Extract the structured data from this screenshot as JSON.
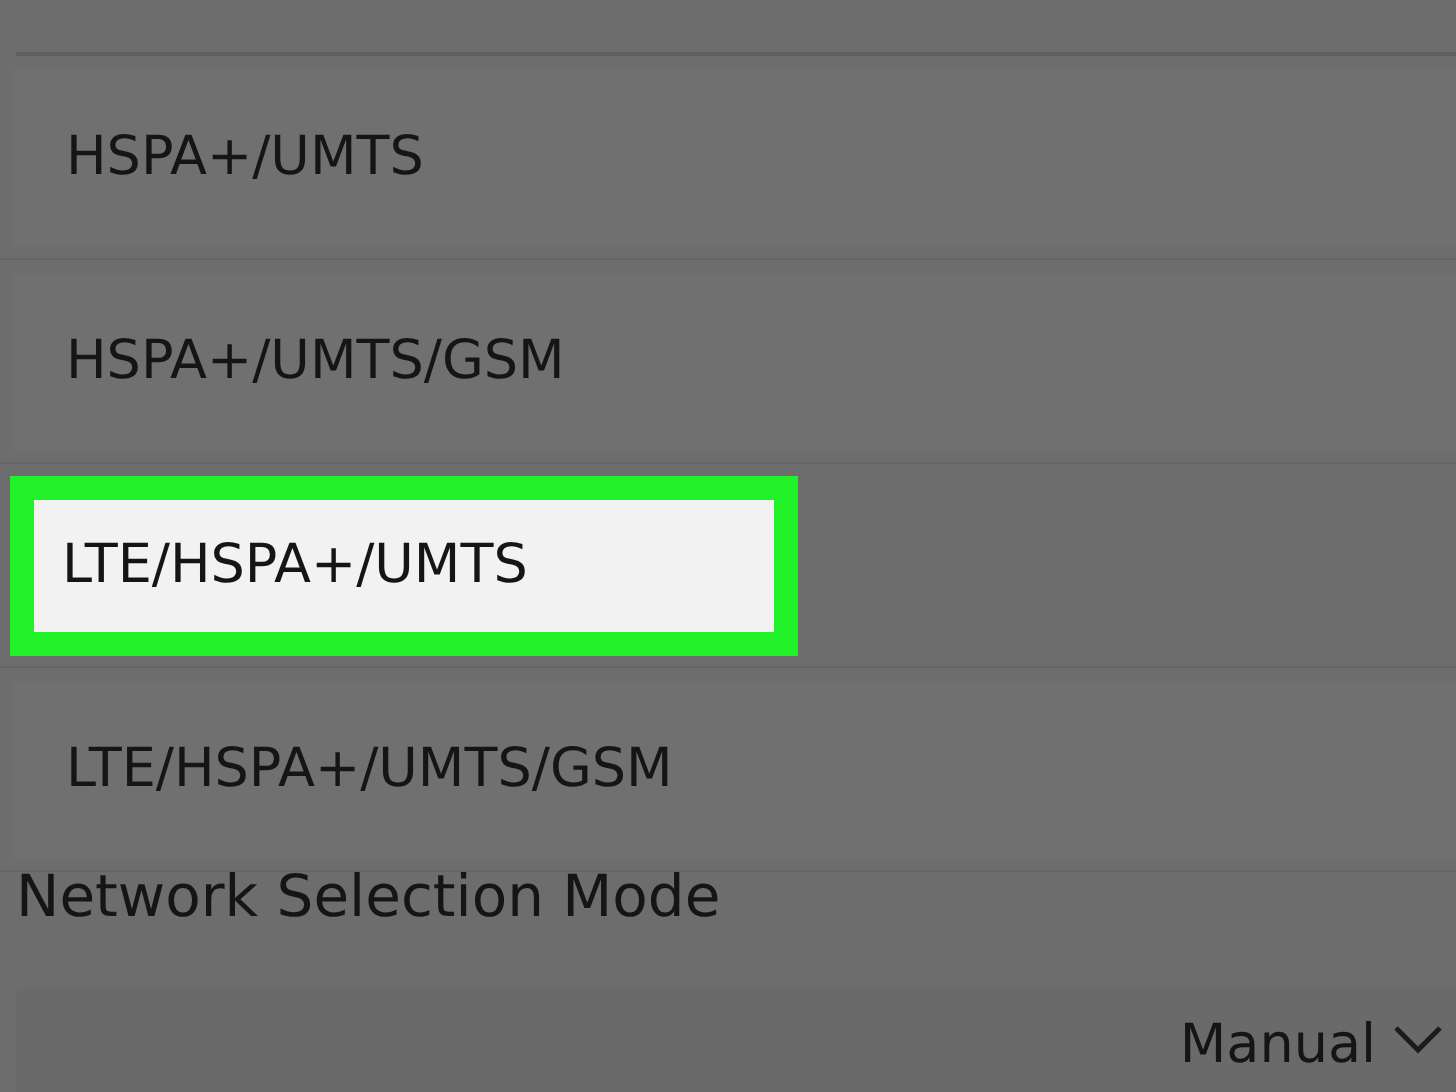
{
  "network_mode_options": [
    {
      "label": "HSPA+/UMTS",
      "selected": false
    },
    {
      "label": "HSPA+/UMTS/GSM",
      "selected": false
    },
    {
      "label": "LTE/HSPA+/UMTS",
      "selected": true
    },
    {
      "label": "LTE/HSPA+/UMTS/GSM",
      "selected": false
    }
  ],
  "network_selection_mode": {
    "title": "Network Selection Mode",
    "value": "Manual"
  }
}
